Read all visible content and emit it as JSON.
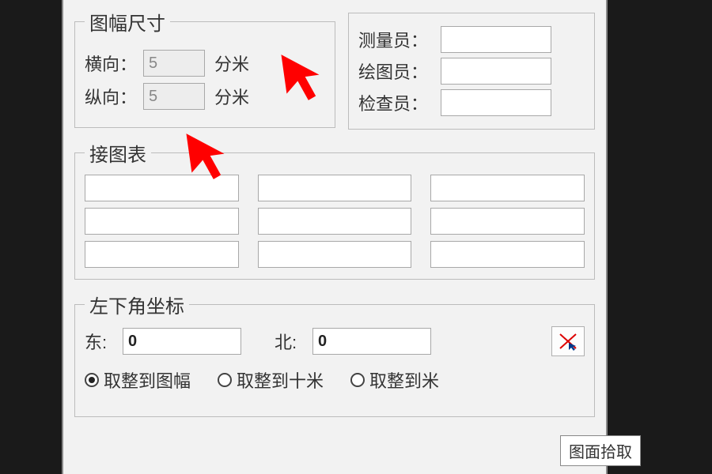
{
  "size_group": {
    "legend": "图幅尺寸",
    "horizontal_label": "横向：",
    "horizontal_value": "5",
    "horizontal_unit": "分米",
    "vertical_label": "纵向：",
    "vertical_value": "5",
    "vertical_unit": "分米"
  },
  "persons": {
    "surveyor_label": "测量员：",
    "surveyor_value": "",
    "drafter_label": "绘图员：",
    "drafter_value": "",
    "inspector_label": "检查员：",
    "inspector_value": ""
  },
  "adjacency": {
    "legend": "接图表",
    "cells": [
      "",
      "",
      "",
      "",
      "",
      "",
      "",
      "",
      ""
    ]
  },
  "corner": {
    "legend": "左下角坐标",
    "east_label": "东:",
    "east_value": "0",
    "north_label": "北:",
    "north_value": "0",
    "radios": {
      "options": [
        "取整到图幅",
        "取整到十米",
        "取整到米"
      ],
      "selected_index": 0
    }
  },
  "tooltip": "图面拾取",
  "colors": {
    "panel_bg": "#f2f2f2",
    "border": "#bcbcbc",
    "arrow": "#ff0000"
  }
}
